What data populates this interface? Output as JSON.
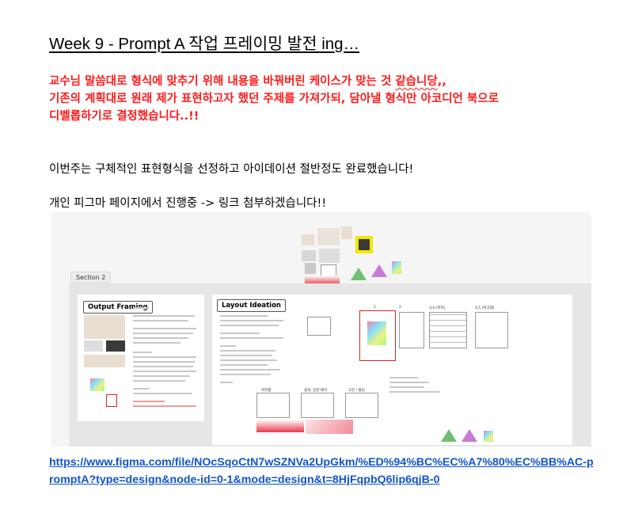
{
  "document": {
    "title": "Week 9 - Prompt A 작업 프레이밍 발전 ing…",
    "red_paragraph": {
      "line1_main": "교수님 말씀대로 형식에 맞추기 위해 내용을 바꿔버린 케이스가 맞는 것 ",
      "line1_underlined": "같습니당",
      "line1_end": ",,",
      "line2": "기존의 계획대로 원래 제가 표현하고자 했던 주제를 가져가되, 담아낼 형식만 아코디언 북으로",
      "line3": "디벨롭하기로 결정했습니다..!!"
    },
    "paragraph_1": "이번주는 구체적인 표현형식을 선정하고 아이데이션 절반정도 완료했습니다!",
    "paragraph_2": "개인 피그마 페이지에서 진행중 -> 링크 첨부하겠습니다!!",
    "link_text": "https://www.figma.com/file/NOcSqoCtN7wSZNVa2UpGkm/%ED%94%BC%EC%A7%80%EC%BB%AC-promptA?type=design&node-id=0-1&mode=design&t=8HjFqpbQ6lip6qjB-0"
  },
  "figma": {
    "section_label": "Section 2",
    "board_a_title": "Output Framing",
    "board_b_title": "Layout Ideation",
    "page_numbers": [
      "1",
      "2",
      "3,4 (뒤지)",
      "4,5 (뒤고맵)"
    ],
    "sub_labels": [
      "뒤지맵",
      "섬게, 강한 배치",
      "고전 / 몰딩"
    ]
  },
  "colors": {
    "red_text": "#ff1a1a",
    "link": "#1155cc",
    "canvas_bg": "#f5f5f5",
    "section_bg": "#e6e6e6"
  }
}
